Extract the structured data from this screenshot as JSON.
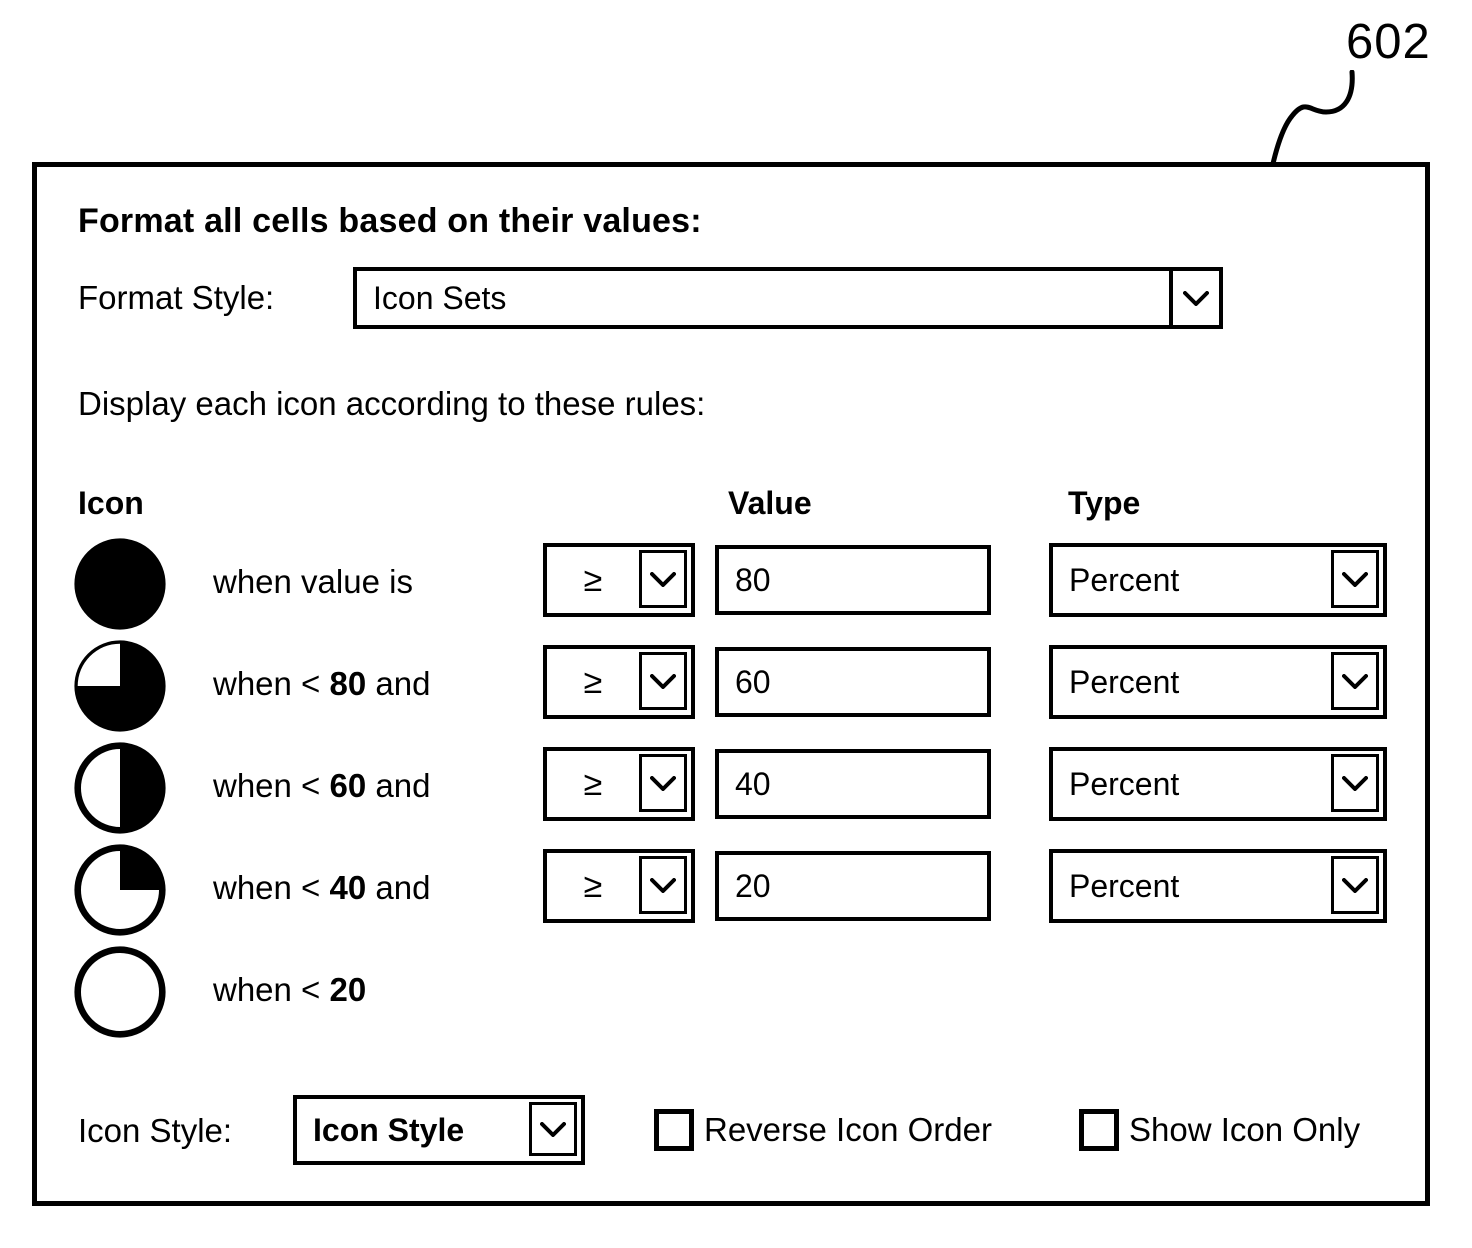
{
  "figure": {
    "reference_number": "602"
  },
  "dialog": {
    "title": "Format all cells based on their values:",
    "format_style": {
      "label": "Format Style:",
      "value": "Icon Sets",
      "arrow_icon": "chevron-down-icon"
    },
    "rules_instruction": "Display each icon according to these rules:",
    "columns": {
      "icon": "Icon",
      "value": "Value",
      "type": "Type"
    },
    "rules": [
      {
        "icon_name": "pie-icon-full",
        "icon_fill_percent": 100,
        "condition": "when value is",
        "condition_prefix": "when value is",
        "condition_bold": "",
        "condition_suffix": "",
        "operator": "≥",
        "value": "80",
        "type": "Percent"
      },
      {
        "icon_name": "pie-icon-three-quarter",
        "icon_fill_percent": 75,
        "condition": "when  <  80  and",
        "condition_prefix": "when  <  ",
        "condition_bold": "80",
        "condition_suffix": "  and",
        "operator": "≥",
        "value": "60",
        "type": "Percent"
      },
      {
        "icon_name": "pie-icon-half",
        "icon_fill_percent": 50,
        "condition": "when  <  60  and",
        "condition_prefix": "when  <  ",
        "condition_bold": "60",
        "condition_suffix": "  and",
        "operator": "≥",
        "value": "40",
        "type": "Percent"
      },
      {
        "icon_name": "pie-icon-quarter",
        "icon_fill_percent": 25,
        "condition": "when  <  40  and",
        "condition_prefix": "when  <  ",
        "condition_bold": "40",
        "condition_suffix": "  and",
        "operator": "≥",
        "value": "20",
        "type": "Percent"
      },
      {
        "icon_name": "pie-icon-empty",
        "icon_fill_percent": 0,
        "condition": "when  <  20",
        "condition_prefix": "when  <  ",
        "condition_bold": "20",
        "condition_suffix": "",
        "operator": null,
        "value": null,
        "type": null
      }
    ],
    "footer": {
      "icon_style_label": "Icon Style:",
      "icon_style_value": "Icon Style",
      "icon_style_arrow_icon": "chevron-down-icon",
      "reverse_icon_order_label": "Reverse Icon Order",
      "reverse_icon_order_checked": false,
      "show_icon_only_label": "Show Icon Only",
      "show_icon_only_checked": false
    }
  },
  "colors": {
    "ink": "#000000",
    "paper": "#ffffff"
  }
}
